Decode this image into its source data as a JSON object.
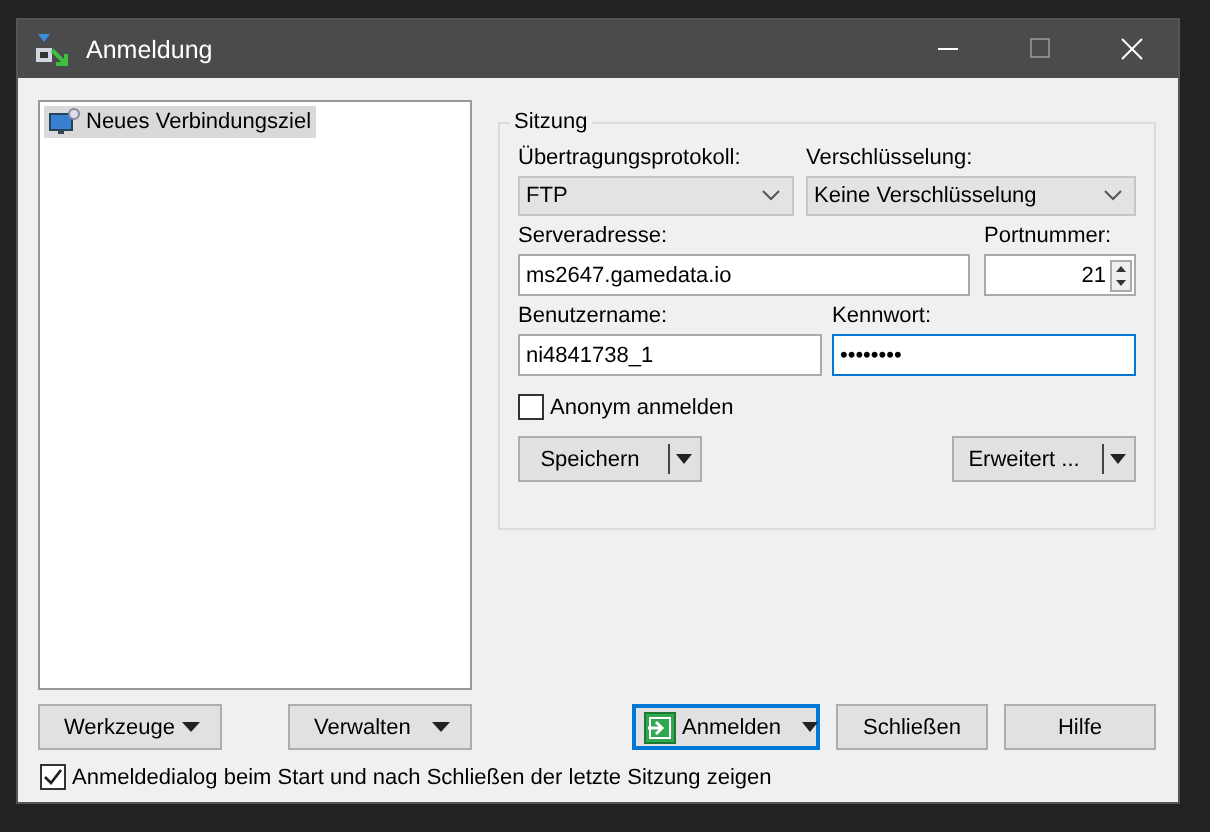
{
  "window": {
    "title": "Anmeldung"
  },
  "sites": [
    {
      "label": "Neues Verbindungsziel",
      "selected": true
    }
  ],
  "session": {
    "title": "Sitzung",
    "protocol": {
      "label": "Übertragungsprotokoll:",
      "value": "FTP"
    },
    "encryption": {
      "label": "Verschlüsselung:",
      "value": "Keine Verschlüsselung"
    },
    "host": {
      "label": "Serveradresse:",
      "value": "ms2647.gamedata.io"
    },
    "port": {
      "label": "Portnummer:",
      "value": "21"
    },
    "user": {
      "label": "Benutzername:",
      "value": "ni4841738_1",
      "focused": false
    },
    "password": {
      "label": "Kennwort:",
      "value": "••••••••",
      "focused": true
    },
    "anonymous": {
      "label": "Anonym anmelden",
      "checked": false
    },
    "save_button": "Speichern",
    "advanced_button": "Erweitert ..."
  },
  "left_buttons": [
    "Werkzeuge",
    "Verwalten"
  ],
  "action_buttons": [
    {
      "label": "Anmelden",
      "kind": "primary"
    },
    {
      "label": "Schließen",
      "kind": "plain"
    },
    {
      "label": "Hilfe",
      "kind": "plain"
    }
  ],
  "show_on_start": {
    "label": "Anmeldedialog beim Start und nach Schließen der letzte Sitzung zeigen",
    "checked": true
  }
}
